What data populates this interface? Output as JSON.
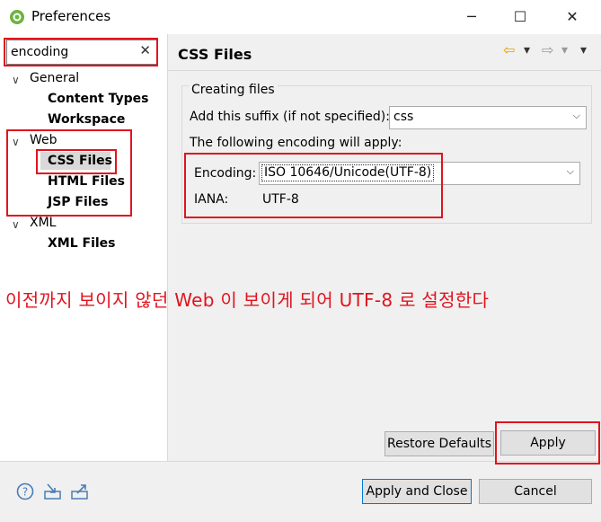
{
  "window": {
    "title": "Preferences",
    "minimize_glyph": "─",
    "maximize_glyph": "☐",
    "close_glyph": "✕"
  },
  "filter": {
    "value": "encoding",
    "clear_glyph": "✕"
  },
  "tree": {
    "general": {
      "label": "General",
      "children": [
        "Content Types",
        "Workspace"
      ]
    },
    "web": {
      "label": "Web",
      "children": [
        "CSS Files",
        "HTML Files",
        "JSP Files"
      ],
      "selected": "CSS Files"
    },
    "xml": {
      "label": "XML",
      "children": [
        "XML Files"
      ]
    },
    "chevron_glyph": "∨"
  },
  "page": {
    "title": "CSS Files",
    "nav": {
      "back_glyph": "⇦",
      "forward_glyph": "⇨",
      "menu_glyph": "▾"
    },
    "group_title": "Creating files",
    "suffix_label": "Add this suffix (if not specified):",
    "suffix_value": "css",
    "encoding_intro": "The following encoding will apply:",
    "encoding_label": "Encoding:",
    "encoding_value": "ISO 10646/Unicode(UTF-8)",
    "iana_label": "IANA:",
    "iana_value": "UTF-8",
    "caret_glyph": "⌵"
  },
  "annotation": {
    "text": "이전까지 보이지 않던 Web 이 보이게 되어 UTF-8 로 설정한다",
    "color": "#e0141e"
  },
  "buttons": {
    "restore_defaults": "Restore Defaults",
    "apply": "Apply",
    "apply_and_close": "Apply and Close",
    "cancel": "Cancel"
  },
  "bottom_icons": [
    "help-icon",
    "import-icon",
    "export-icon"
  ],
  "colors": {
    "accent": "#0078d7",
    "selection": "#d9d9d9",
    "annotation_red": "#e0141e"
  }
}
